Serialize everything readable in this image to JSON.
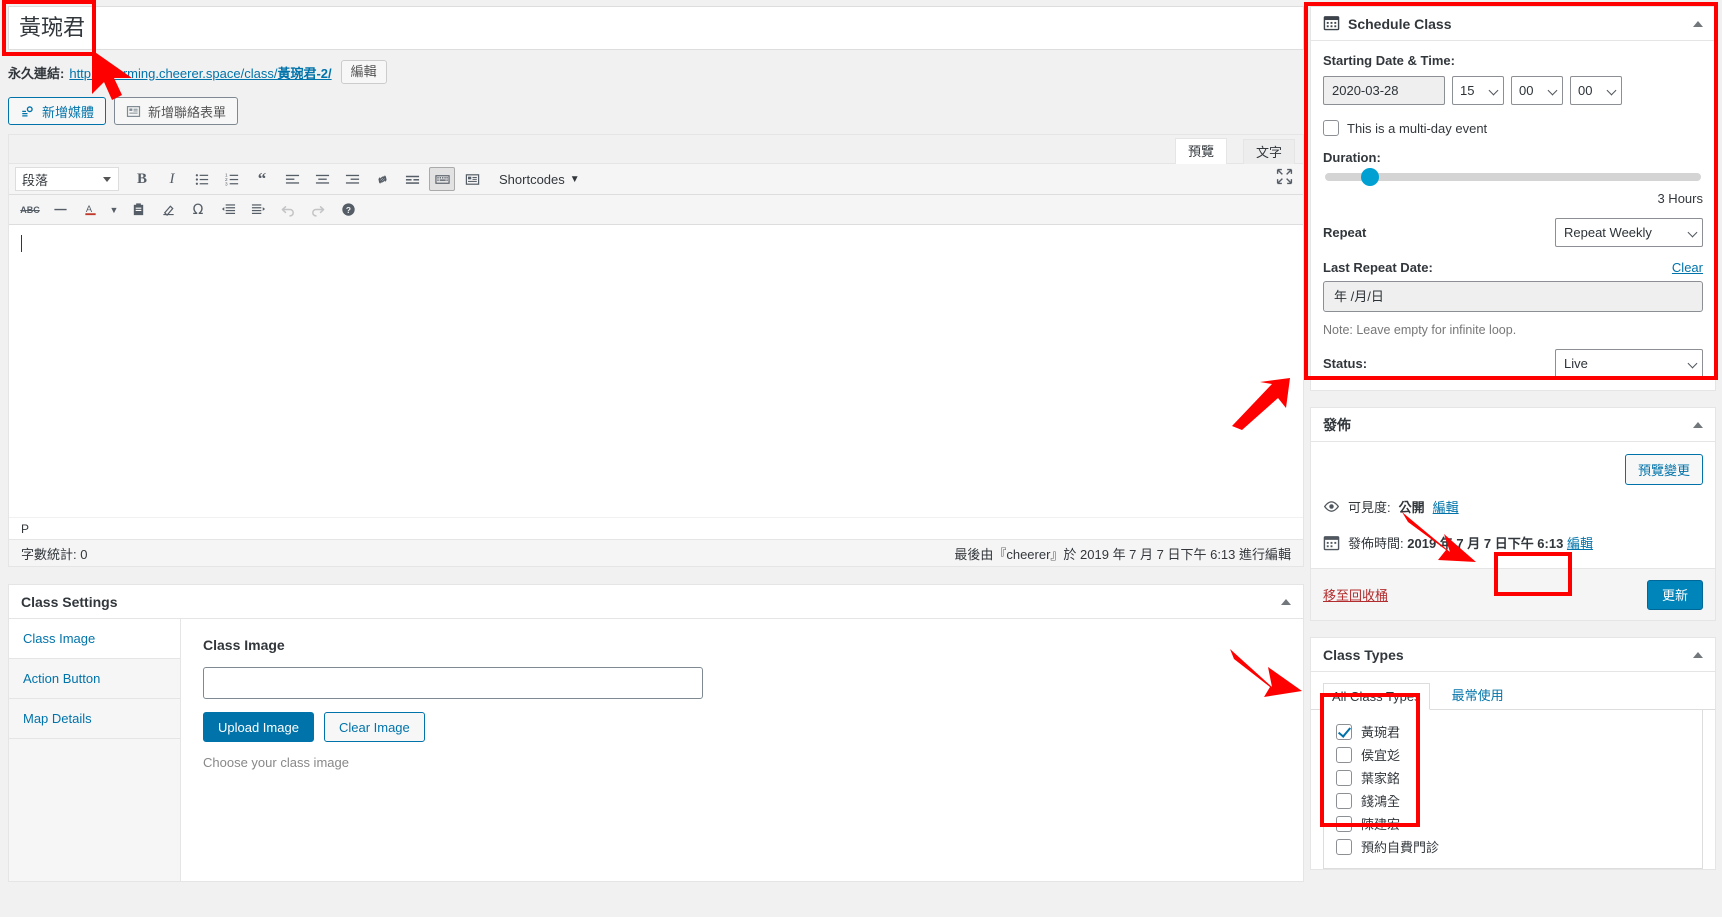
{
  "editor": {
    "title_value": "黃琬君",
    "permalink": {
      "label": "永久連結:",
      "url_text": "http://charming.cheerer.space/class/黃琬君-2/",
      "edit_button": "編輯"
    },
    "media_buttons": {
      "add_media": "新增媒體",
      "add_contact_form": "新增聯絡表單"
    },
    "tabs": {
      "visual": "預覽",
      "text": "文字"
    },
    "toolbar": {
      "format_select": "段落",
      "shortcodes": "Shortcodes",
      "buttons_row1": [
        "bold",
        "italic",
        "bulleted-list",
        "numbered-list",
        "blockquote",
        "align-left",
        "align-center",
        "align-right",
        "insert-link",
        "insert-more",
        "toggle-toolbar",
        "contact-form"
      ],
      "buttons_row2": [
        "strikethrough",
        "horizontal-rule",
        "text-color",
        "paste-as-text",
        "clear-formatting",
        "special-character",
        "outdent",
        "indent",
        "undo",
        "redo",
        "keyboard-shortcuts"
      ]
    },
    "path": "P",
    "word_count": "字數統計: 0",
    "last_edited": "最後由『cheerer』於 2019 年 7 月 7 日下午 6:13 進行編輯"
  },
  "class_settings": {
    "title": "Class Settings",
    "nav": [
      {
        "label": "Class Image",
        "active": true
      },
      {
        "label": "Action Button",
        "active": false
      },
      {
        "label": "Map Details",
        "active": false
      }
    ],
    "panel": {
      "heading": "Class Image",
      "input_value": "",
      "upload_button": "Upload Image",
      "clear_button": "Clear Image",
      "hint": "Choose your class image"
    }
  },
  "schedule_class": {
    "title": "Schedule Class",
    "starting_label": "Starting Date & Time:",
    "date_value": "2020-03-28",
    "hour_value": "15",
    "minute_value": "00",
    "second_value": "00",
    "multiday_label": "This is a multi-day event",
    "multiday_checked": false,
    "duration_label": "Duration:",
    "duration_value": "3 Hours",
    "duration_percent": 12,
    "repeat_label": "Repeat",
    "repeat_value": "Repeat Weekly",
    "last_repeat_label": "Last Repeat Date:",
    "clear_link": "Clear",
    "last_repeat_placeholder": "年 /月/日",
    "note": "Note: Leave empty for infinite loop.",
    "status_label": "Status:",
    "status_value": "Live"
  },
  "publish": {
    "title": "發佈",
    "preview_button": "預覽變更",
    "visibility_label": "可見度:",
    "visibility_value": "公開",
    "visibility_edit": "編輯",
    "publish_time_label": "發佈時間:",
    "publish_time_value": "2019 年 7 月 7 日下午 6:13",
    "publish_time_edit": "編輯",
    "trash_link": "移至回收桶",
    "update_button": "更新"
  },
  "class_types": {
    "title": "Class Types",
    "tab_all": "All Class Types",
    "tab_most_used": "最常使用",
    "items": [
      {
        "label": "黃琬君",
        "checked": true
      },
      {
        "label": "侯宜彣",
        "checked": false
      },
      {
        "label": "葉家銘",
        "checked": false
      },
      {
        "label": "錢鴻全",
        "checked": false
      },
      {
        "label": "陳建宏",
        "checked": false
      },
      {
        "label": "預約自費門診",
        "checked": false
      }
    ]
  },
  "colors": {
    "accent": "#0073aa",
    "primary_button": "#0085ba",
    "annotation_red": "#ff0000",
    "slider": "#00a0d2"
  }
}
